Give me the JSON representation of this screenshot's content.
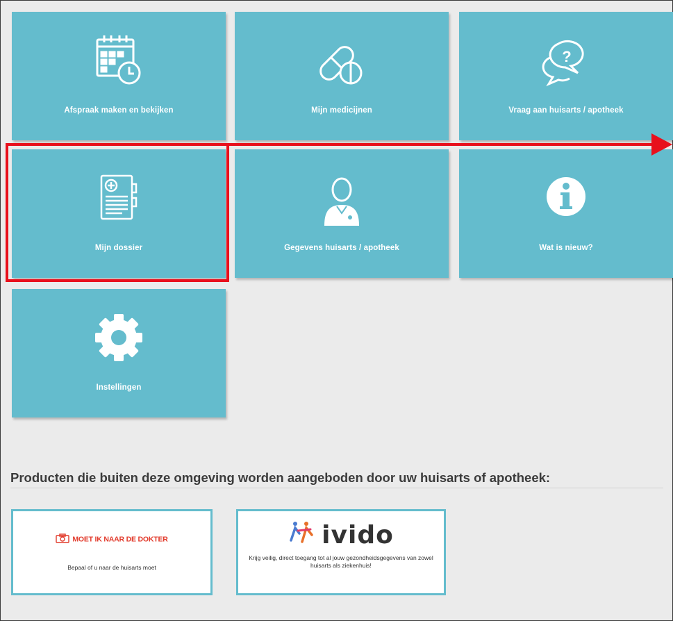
{
  "tiles": [
    {
      "label": "Afspraak maken en bekijken",
      "icon": "calendar-clock-icon"
    },
    {
      "label": "Mijn medicijnen",
      "icon": "pills-icon"
    },
    {
      "label": "Vraag aan huisarts / apotheek",
      "icon": "question-chat-icon"
    },
    {
      "label": "Mijn dossier",
      "icon": "medical-document-icon"
    },
    {
      "label": "Gegevens huisarts / apotheek",
      "icon": "doctor-icon"
    },
    {
      "label": "Wat is nieuw?",
      "icon": "info-icon"
    },
    {
      "label": "Instellingen",
      "icon": "gear-icon"
    }
  ],
  "products": {
    "heading": "Producten die buiten deze omgeving worden aangeboden door uw huisarts of apotheek:",
    "items": [
      {
        "brand": "MOET IK NAAR DE DOKTER",
        "description": "Bepaal of u naar de huisarts moet"
      },
      {
        "brand": "ivido",
        "description": "Krijg veilig, direct toegang tot al jouw gezondheidsgegevens van zowel huisarts als ziekenhuis!"
      }
    ]
  },
  "colors": {
    "tile": "#64bccd",
    "highlight": "#e8101c",
    "background": "#ebebeb"
  }
}
